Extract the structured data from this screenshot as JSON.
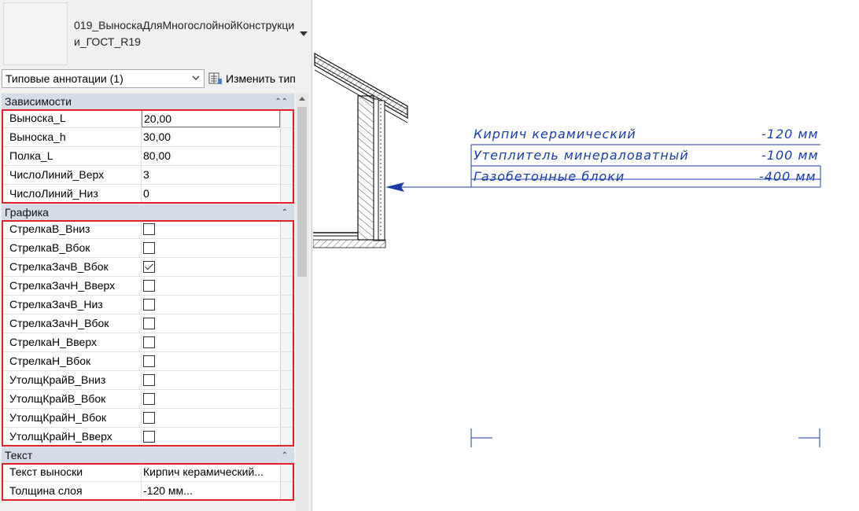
{
  "type_selector": {
    "family_name": "019_ВыноскаДляМногослойнойКонструкции_ГОСТ_R19",
    "instance_filter": "Типовые аннотации (1)",
    "edit_type_label": "Изменить тип"
  },
  "groups": {
    "constraints": {
      "title": "Зависимости",
      "rows": [
        {
          "name": "Выноска_L",
          "value": "20,00"
        },
        {
          "name": "Выноска_h",
          "value": "30,00"
        },
        {
          "name": "Полка_L",
          "value": "80,00"
        },
        {
          "name": "ЧислоЛиний_Верх",
          "value": "3"
        },
        {
          "name": "ЧислоЛиний_Низ",
          "value": "0"
        }
      ]
    },
    "graphics": {
      "title": "Графика",
      "rows": [
        {
          "name": "СтрелкаВ_Вниз",
          "checked": false
        },
        {
          "name": "СтрелкаВ_Вбок",
          "checked": false
        },
        {
          "name": "СтрелкаЗачВ_Вбок",
          "checked": true
        },
        {
          "name": "СтрелкаЗачН_Вверх",
          "checked": false
        },
        {
          "name": "СтрелкаЗачВ_Низ",
          "checked": false
        },
        {
          "name": "СтрелкаЗачН_Вбок",
          "checked": false
        },
        {
          "name": "СтрелкаН_Вверх",
          "checked": false
        },
        {
          "name": "СтрелкаН_Вбок",
          "checked": false
        },
        {
          "name": "УтолщКрайВ_Вниз",
          "checked": false
        },
        {
          "name": "УтолщКрайВ_Вбок",
          "checked": false
        },
        {
          "name": "УтолщКрайН_Вбок",
          "checked": false
        },
        {
          "name": "УтолщКрайН_Вверх",
          "checked": false
        }
      ]
    },
    "text": {
      "title": "Текст",
      "rows": [
        {
          "name": "Текст выноски",
          "value": "Кирпич керамический..."
        },
        {
          "name": "Толщина слоя",
          "value": "-120 мм..."
        }
      ]
    }
  },
  "drawing": {
    "layers": [
      {
        "material": "Кирпич керамический",
        "thickness": "-120 мм"
      },
      {
        "material": "Утеплитель минераловатный",
        "thickness": "-100 мм"
      },
      {
        "material": "Газобетонные блоки",
        "thickness": "-400 мм"
      }
    ],
    "note_color": "#1b3ea3"
  },
  "colors": {
    "highlight": "#e0202a",
    "group_header": "#d4dde7"
  }
}
